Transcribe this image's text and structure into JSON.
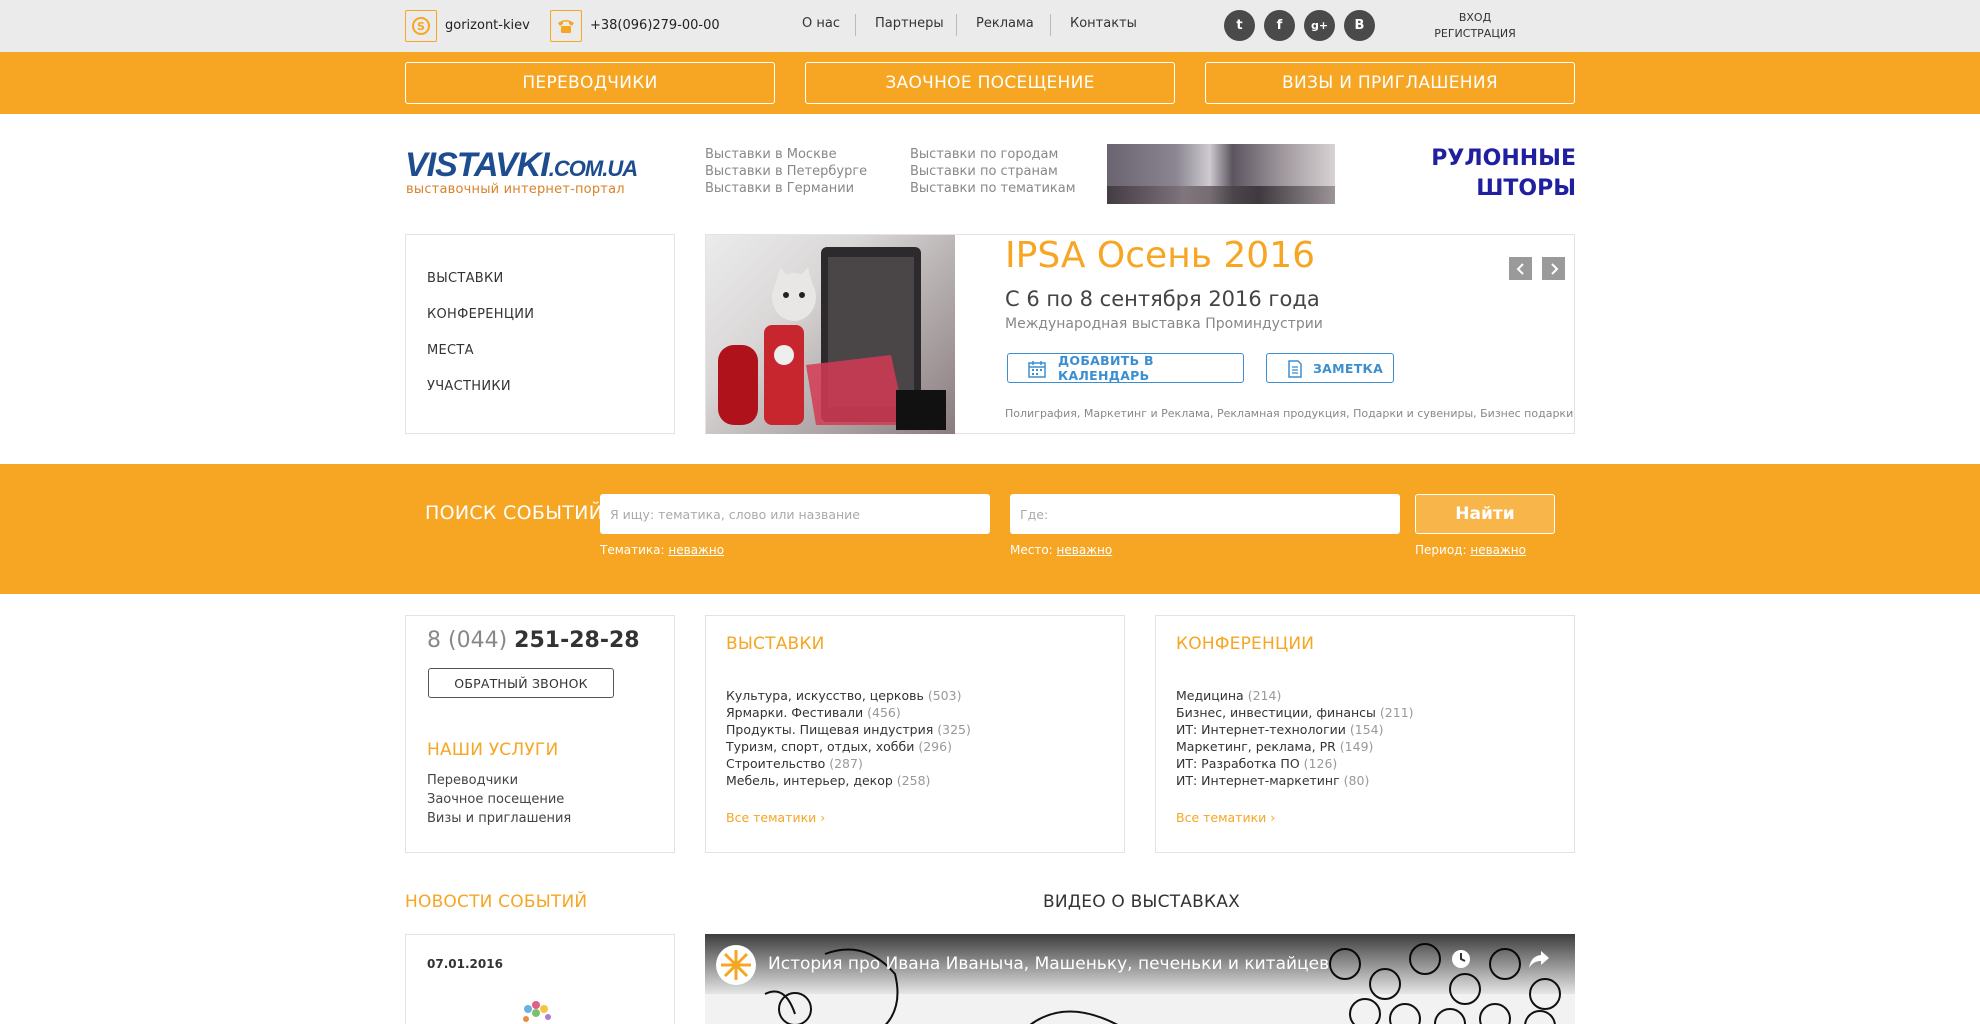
{
  "topbar": {
    "skype": "gorizont-kiev",
    "phone": "+38(096)279-00-00",
    "nav": [
      "О нас",
      "Партнеры",
      "Реклама",
      "Контакты"
    ],
    "social": [
      {
        "name": "twitter-icon",
        "glyph": "t"
      },
      {
        "name": "facebook-icon",
        "glyph": "f"
      },
      {
        "name": "googleplus-icon",
        "glyph": "g+"
      },
      {
        "name": "vk-icon",
        "glyph": "В"
      }
    ],
    "login": "ВХОД",
    "register": "РЕГИСТРАЦИЯ"
  },
  "orange_nav": [
    "ПЕРЕВОДЧИКИ",
    "ЗАОЧНОЕ ПОСЕЩЕНИЕ",
    "ВИЗЫ И ПРИГЛАШЕНИЯ"
  ],
  "logo": {
    "main": "VISTAVKI",
    "domain": ".COM.UA",
    "sub": "выставочный интернет-портал"
  },
  "header_links": {
    "col1": [
      "Выставки в Москве",
      "Выставки в Петербурге",
      "Выставки в Германии"
    ],
    "col2": [
      "Выставки по городам",
      "Выставки по странам",
      "Выставки по тематикам"
    ]
  },
  "banner": {
    "text": "РУЛОННЫЕ ШТОРЫ"
  },
  "side_menu": [
    "ВЫСТАВКИ",
    "КОНФЕРЕНЦИИ",
    "МЕСТА",
    "УЧАСТНИКИ"
  ],
  "event": {
    "title": "IPSA Осень 2016",
    "date": "С 6 по 8 сентября 2016 года",
    "desc": "Международная выставка Проминдустрии",
    "btn_calendar": "ДОБАВИТЬ В КАЛЕНДАРЬ",
    "btn_note": "ЗАМЕТКА",
    "tags": "Полиграфия, Маркетинг и Реклама, Рекламная продукция, Подарки и сувениры, Бизнес подарки"
  },
  "search": {
    "title": "ПОИСК СОБЫТИЙ",
    "what_placeholder": "Я ищу: тематика, слово или название",
    "where_placeholder": "Где:",
    "button": "Найти",
    "theme_label": "Тематика:",
    "place_label": "Место:",
    "period_label": "Период:",
    "any": "неважно"
  },
  "contact": {
    "phone_code": "8 (044)",
    "phone_num": "251-28-28",
    "callback": "ОБРАТНЫЙ ЗВОНОК",
    "services_title": "НАШИ УСЛУГИ",
    "services": [
      "Переводчики",
      "Заочное посещение",
      "Визы и приглашения"
    ]
  },
  "exhibitions": {
    "title": "ВЫСТАВКИ",
    "items": [
      {
        "name": "Культура, искусство, церковь",
        "count": "(503)"
      },
      {
        "name": "Ярмарки. Фестивали",
        "count": "(456)"
      },
      {
        "name": "Продукты. Пищевая индустрия",
        "count": "(325)"
      },
      {
        "name": "Туризм, спорт, отдых, хобби",
        "count": "(296)"
      },
      {
        "name": "Строительство",
        "count": "(287)"
      },
      {
        "name": "Мебель, интерьер, декор",
        "count": "(258)"
      }
    ],
    "all": "Все тематики"
  },
  "conferences": {
    "title": "КОНФЕРЕНЦИИ",
    "items": [
      {
        "name": "Медицина",
        "count": "(214)"
      },
      {
        "name": "Бизнес, инвестиции, финансы",
        "count": "(211)"
      },
      {
        "name": "ИТ: Интернет-технологии",
        "count": "(154)"
      },
      {
        "name": "Маркетинг, реклама, PR",
        "count": "(149)"
      },
      {
        "name": "ИТ: Разработка ПО",
        "count": "(126)"
      },
      {
        "name": "ИТ: Интернет-маркетинг",
        "count": "(80)"
      }
    ],
    "all": "Все тематики"
  },
  "news": {
    "title": "НОВОСТИ СОБЫТИЙ",
    "date": "07.01.2016"
  },
  "video": {
    "title": "ВИДЕО О ВЫСТАВКАХ",
    "caption": "История про Ивана Иваныча, Машеньку, печеньки и китайцев"
  },
  "colors": {
    "accent": "#f6a623",
    "link_blue": "#3b8fd0",
    "logo_blue": "#1d4d8f"
  }
}
